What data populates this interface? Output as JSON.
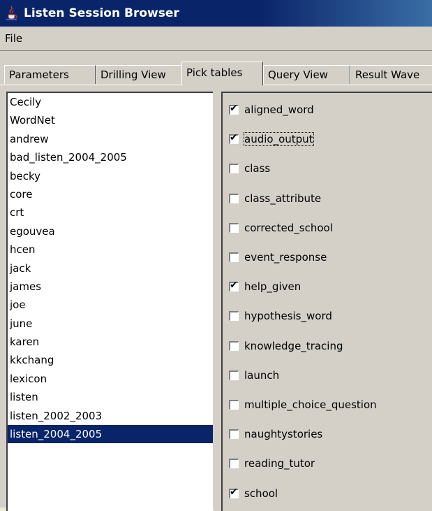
{
  "window": {
    "title": "Listen Session Browser",
    "icon": "java-cup-icon"
  },
  "menu": {
    "items": [
      "File"
    ]
  },
  "tabs": [
    {
      "label": "Parameters",
      "selected": false
    },
    {
      "label": "Drilling View",
      "selected": false
    },
    {
      "label": "Pick tables",
      "selected": true
    },
    {
      "label": "Query View",
      "selected": false
    },
    {
      "label": "Result Wave",
      "selected": false
    }
  ],
  "databases": {
    "items": [
      "Cecily",
      "WordNet",
      "andrew",
      "bad_listen_2004_2005",
      "becky",
      "core",
      "crt",
      "egouvea",
      "hcen",
      "jack",
      "james",
      "joe",
      "june",
      "karen",
      "kkchang",
      "lexicon",
      "listen",
      "listen_2002_2003",
      "listen_2004_2005"
    ],
    "selected": "listen_2004_2005"
  },
  "tables": {
    "items": [
      {
        "label": "aligned_word",
        "checked": true
      },
      {
        "label": "audio_output",
        "checked": true,
        "focused": true
      },
      {
        "label": "class",
        "checked": false
      },
      {
        "label": "class_attribute",
        "checked": false
      },
      {
        "label": "corrected_school",
        "checked": false
      },
      {
        "label": "event_response",
        "checked": false
      },
      {
        "label": "help_given",
        "checked": true
      },
      {
        "label": "hypothesis_word",
        "checked": false
      },
      {
        "label": "knowledge_tracing",
        "checked": false
      },
      {
        "label": "launch",
        "checked": false
      },
      {
        "label": "multiple_choice_question",
        "checked": false
      },
      {
        "label": "naughtystories",
        "checked": false
      },
      {
        "label": "reading_tutor",
        "checked": false
      },
      {
        "label": "school",
        "checked": true
      }
    ]
  },
  "colors": {
    "titlebar": "#0a246a",
    "selection": "#0a246a",
    "chrome": "#d4d0c8"
  }
}
